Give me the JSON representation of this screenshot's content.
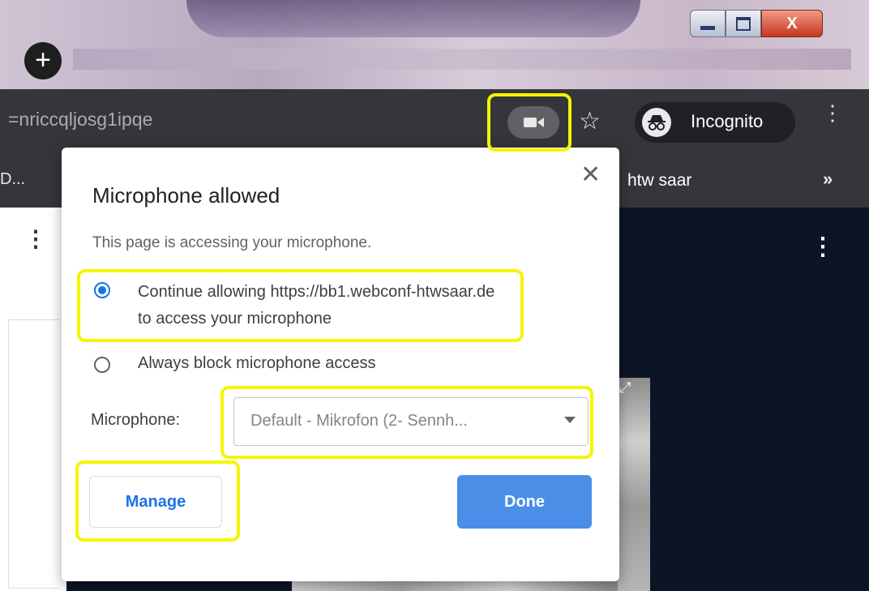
{
  "browser": {
    "url_fragment": "=nriccqljosg1ipqe",
    "profile_label": "Incognito",
    "new_tab_symbol": "+",
    "more_symbol": "⋮",
    "star_symbol": "☆",
    "close_window_symbol": "X"
  },
  "bookmarks": {
    "truncated_item": "D...",
    "item": "htw saar",
    "overflow_symbol": "»"
  },
  "popup": {
    "title": "Microphone allowed",
    "subtitle": "This page is accessing your microphone.",
    "close_symbol": "✕",
    "options": [
      {
        "label": "Continue allowing https://bb1.webconf-htwsaar.de to access your microphone",
        "selected": true
      },
      {
        "label": "Always block microphone access",
        "selected": false
      }
    ],
    "microphone_label": "Microphone:",
    "microphone_value": "Default - Mikrofon (2- Sennh...",
    "manage_label": "Manage",
    "done_label": "Done"
  },
  "page": {
    "kebab_symbol": "⋮",
    "expand_symbol": "⤢"
  },
  "colors": {
    "accent": "#1a73e8",
    "done_button": "#4a8ee8",
    "highlight": "#f5f500",
    "toolbar": "#35363a",
    "page_background": "#0b1526"
  },
  "icons": [
    "new-tab-icon",
    "camera-icon",
    "star-icon",
    "incognito-icon",
    "kebab-icon",
    "close-icon",
    "chevron-double-right-icon",
    "dropdown-arrow-icon",
    "expand-icon"
  ]
}
